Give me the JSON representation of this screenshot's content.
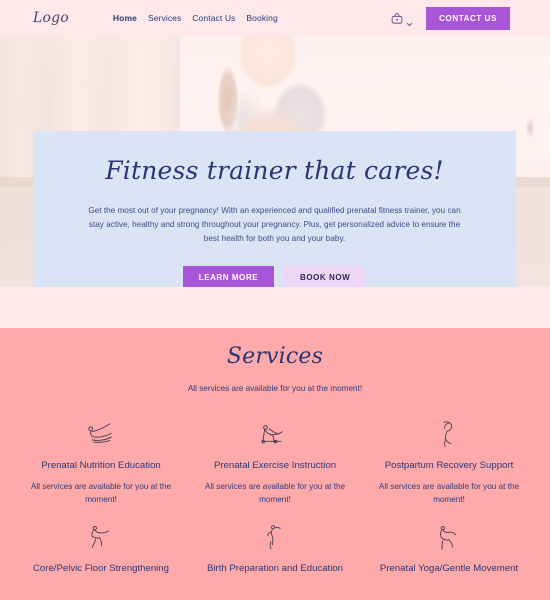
{
  "navbar": {
    "logo": "Logo",
    "links": [
      {
        "label": "Home",
        "active": true
      },
      {
        "label": "Services",
        "active": false
      },
      {
        "label": "Contact Us",
        "active": false
      },
      {
        "label": "Booking",
        "active": false
      }
    ],
    "cart_icon": "shopping-bag-icon",
    "chevron_icon": "chevron-down-icon",
    "cta_label": "CONTACT US",
    "cta_color": "#a855d8",
    "background": "#fde9e9"
  },
  "hero": {
    "image_alt": "pregnant woman in yoga prayer pose",
    "card_background": "#dbe4f5",
    "title": "Fitness trainer that cares!",
    "description": "Get the most out of your pregnancy! With an experienced and qualified prenatal fitness trainer, you can stay active, healthy and strong throughout your pregnancy. Plus, get personalized advice to ensure the best health for both you and your baby.",
    "primary_button": "LEARN MORE",
    "secondary_button": "BOOK NOW",
    "primary_color": "#a855d8",
    "secondary_color": "#eed6f7"
  },
  "services": {
    "background": "#ffaaaa",
    "title": "Services",
    "subtitle": "All services are available for you at the moment!",
    "items": [
      {
        "icon": "yoga-seated-forward-bend-icon",
        "title": "Prenatal Nutrition Education",
        "description": "All services are available for you at the moment!"
      },
      {
        "icon": "yoga-table-top-pose-icon",
        "title": "Prenatal Exercise Instruction",
        "description": "All services are available for you at the moment!"
      },
      {
        "icon": "yoga-standing-stretch-icon",
        "title": "Postpartum Recovery Support",
        "description": "All services are available for you at the moment!"
      },
      {
        "icon": "yoga-warrior-pose-icon",
        "title": "Core/Pelvic Floor Strengthening",
        "description": ""
      },
      {
        "icon": "yoga-standing-balance-icon",
        "title": "Birth Preparation and Education",
        "description": ""
      },
      {
        "icon": "yoga-dancer-pose-icon",
        "title": "Prenatal Yoga/Gentle Movement",
        "description": ""
      }
    ]
  }
}
